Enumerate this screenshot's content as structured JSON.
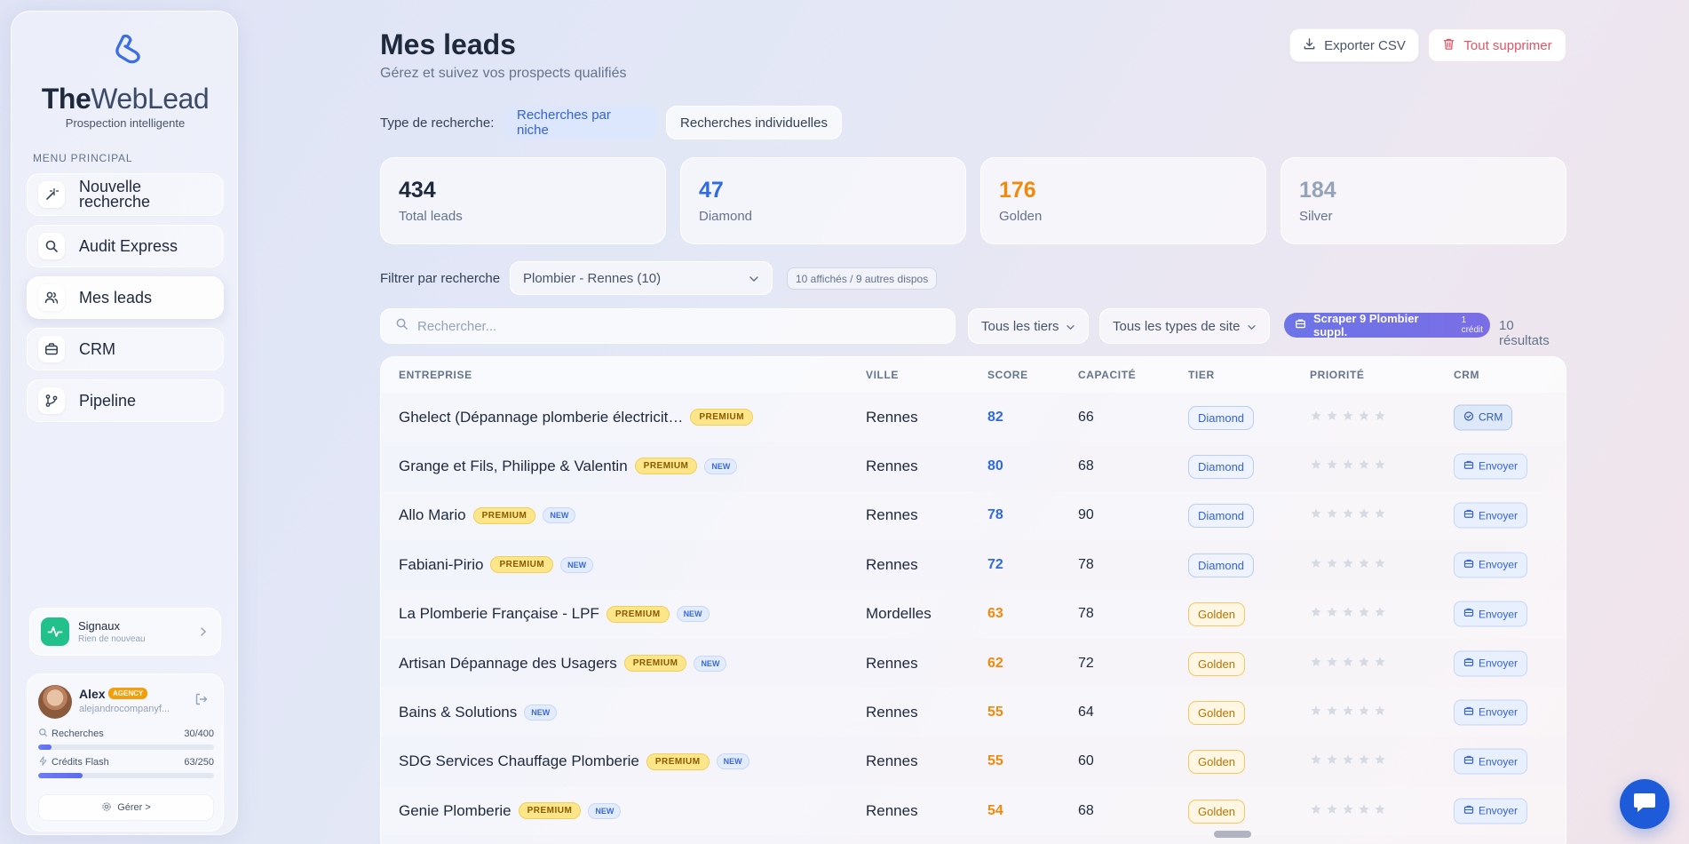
{
  "brand": {
    "name_part1": "The",
    "name_part2": "WebLead",
    "tagline": "Prospection intelligente"
  },
  "sidebar": {
    "menu_title": "MENU PRINCIPAL",
    "items": [
      {
        "label": "Nouvelle recherche",
        "icon": "magic-wand-icon",
        "active": false
      },
      {
        "label": "Audit Express",
        "icon": "search-icon",
        "active": false
      },
      {
        "label": "Mes leads",
        "icon": "users-icon",
        "active": true
      },
      {
        "label": "CRM",
        "icon": "briefcase-icon",
        "active": false
      },
      {
        "label": "Pipeline",
        "icon": "branch-icon",
        "active": false
      }
    ],
    "signals": {
      "title": "Signaux",
      "subtitle": "Rien de nouveau"
    },
    "user": {
      "name": "Alex",
      "plan_badge": "AGENCY",
      "email": "alejandrocompanyf...",
      "searches_label": "Recherches",
      "searches_value": "30/400",
      "searches_fraction": 0.075,
      "credits_label": "Crédits Flash",
      "credits_value": "63/250",
      "credits_fraction": 0.252,
      "manage_label": "Gérer >"
    }
  },
  "header": {
    "title": "Mes leads",
    "subtitle": "Gérez et suivez vos prospects qualifiés",
    "export_label": "Exporter CSV",
    "delete_label": "Tout supprimer"
  },
  "search_type": {
    "label": "Type de recherche:",
    "options": [
      "Recherches par niche",
      "Recherches individuelles"
    ],
    "selected": 0
  },
  "stats": [
    {
      "value": "434",
      "label": "Total leads",
      "color": "#1e293b"
    },
    {
      "value": "47",
      "label": "Diamond",
      "color": "#2f6ae0"
    },
    {
      "value": "176",
      "label": "Golden",
      "color": "#f08a0c"
    },
    {
      "value": "184",
      "label": "Silver",
      "color": "#94a3b8"
    }
  ],
  "filters": {
    "label": "Filtrer par recherche",
    "selected_search": "Plombier - Rennes (10)",
    "chip": "10 affichés / 9 autres dispos",
    "search_placeholder": "Rechercher...",
    "tier_dropdown": "Tous les tiers",
    "site_dropdown": "Tous les types de site",
    "scrape_label": "Scraper 9 Plombier suppl.",
    "scrape_credit": "1 crédit",
    "results": "10 résultats"
  },
  "table": {
    "headers": [
      "ENTREPRISE",
      "VILLE",
      "SCORE",
      "CAPACITÉ",
      "TIER",
      "PRIORITÉ",
      "CRM"
    ],
    "rows": [
      {
        "company": "Ghelect (Dépannage plomberie électricit…",
        "premium": "PREMIUM",
        "new": "",
        "city": "Rennes",
        "score": "82",
        "capacity": "66",
        "tier": "Diamond",
        "crm": "CRM",
        "crm_done": true
      },
      {
        "company": "Grange et Fils, Philippe & Valentin",
        "premium": "PREMIUM",
        "new": "NEW",
        "city": "Rennes",
        "score": "80",
        "capacity": "68",
        "tier": "Diamond",
        "crm": "Envoyer",
        "crm_done": false
      },
      {
        "company": "Allo Mario",
        "premium": "PREMIUM",
        "new": "NEW",
        "city": "Rennes",
        "score": "78",
        "capacity": "90",
        "tier": "Diamond",
        "crm": "Envoyer",
        "crm_done": false
      },
      {
        "company": "Fabiani-Pirio",
        "premium": "PREMIUM",
        "new": "NEW",
        "city": "Rennes",
        "score": "72",
        "capacity": "78",
        "tier": "Diamond",
        "crm": "Envoyer",
        "crm_done": false
      },
      {
        "company": "La Plomberie Française - LPF",
        "premium": "PREMIUM",
        "new": "NEW",
        "city": "Mordelles",
        "score": "63",
        "capacity": "78",
        "tier": "Golden",
        "crm": "Envoyer",
        "crm_done": false
      },
      {
        "company": "Artisan Dépannage des Usagers",
        "premium": "PREMIUM",
        "new": "NEW",
        "city": "Rennes",
        "score": "62",
        "capacity": "72",
        "tier": "Golden",
        "crm": "Envoyer",
        "crm_done": false
      },
      {
        "company": "Bains & Solutions",
        "premium": "",
        "new": "NEW",
        "city": "Rennes",
        "score": "55",
        "capacity": "64",
        "tier": "Golden",
        "crm": "Envoyer",
        "crm_done": false
      },
      {
        "company": "SDG Services Chauffage Plomberie",
        "premium": "PREMIUM",
        "new": "NEW",
        "city": "Rennes",
        "score": "55",
        "capacity": "60",
        "tier": "Golden",
        "crm": "Envoyer",
        "crm_done": false
      },
      {
        "company": "Genie Plomberie",
        "premium": "PREMIUM",
        "new": "NEW",
        "city": "Rennes",
        "score": "54",
        "capacity": "68",
        "tier": "Golden",
        "crm": "Envoyer",
        "crm_done": false
      }
    ]
  },
  "colors": {
    "accent": "#3563d8",
    "diamond_score": "#2f6ae0",
    "golden_score": "#f08a0c"
  }
}
